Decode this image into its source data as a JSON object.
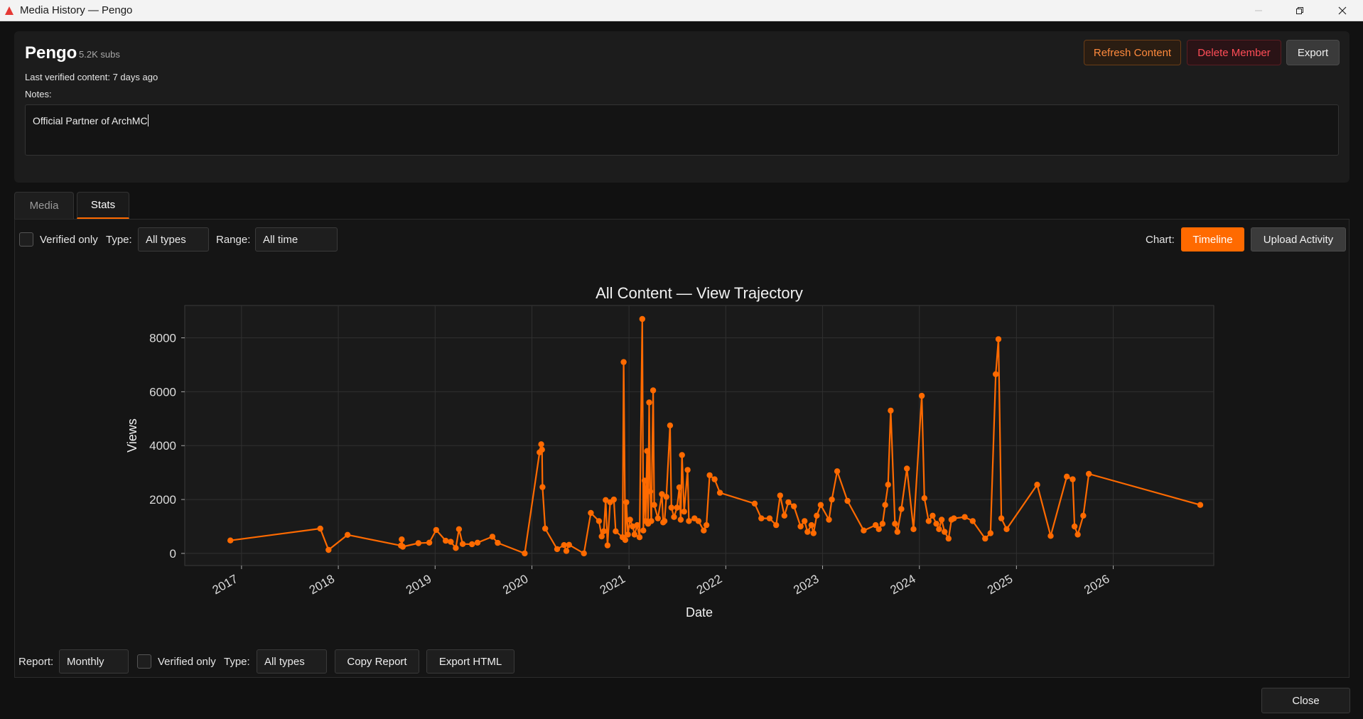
{
  "window": {
    "title": "Media History — Pengo"
  },
  "member": {
    "name": "Pengo",
    "subs": "5.2K subs",
    "last_verified": "Last verified content: 7 days ago",
    "notes_label": "Notes:",
    "notes_value": "Official Partner of ArchMC"
  },
  "header_buttons": {
    "refresh": "Refresh Content",
    "delete": "Delete Member",
    "export": "Export"
  },
  "tabs": [
    {
      "label": "Media",
      "active": false
    },
    {
      "label": "Stats",
      "active": true
    }
  ],
  "filters": {
    "verified_only": "Verified only",
    "type_label": "Type:",
    "type_value": "All types",
    "range_label": "Range:",
    "range_value": "All time",
    "chart_label": "Chart:",
    "chart_timeline": "Timeline",
    "chart_upload": "Upload Activity"
  },
  "report": {
    "report_label": "Report:",
    "report_value": "Monthly",
    "verified_only": "Verified only",
    "type_label": "Type:",
    "type_value": "All types",
    "copy": "Copy Report",
    "export_html": "Export HTML"
  },
  "close_label": "Close",
  "colors": {
    "accent": "#ff6a00",
    "background": "#111111",
    "panel": "#1c1c1c"
  },
  "chart_data": {
    "type": "line",
    "title": "All Content — View Trajectory",
    "xlabel": "Date",
    "ylabel": "Views",
    "xlim": [
      "2016-06-01",
      "2027-01-15"
    ],
    "ylim": [
      -450,
      9200
    ],
    "x_ticks": [
      "2017",
      "2018",
      "2019",
      "2020",
      "2021",
      "2022",
      "2023",
      "2024",
      "2025",
      "2026"
    ],
    "y_ticks": [
      0,
      2000,
      4000,
      6000,
      8000
    ],
    "grid": true,
    "series": [
      {
        "color": "#ff6a00",
        "points": [
          [
            "2016-11-20",
            480
          ],
          [
            "2017-10-25",
            920
          ],
          [
            "2017-11-25",
            130
          ],
          [
            "2018-02-05",
            690
          ],
          [
            "2018-08-25",
            290
          ],
          [
            "2018-08-28",
            520
          ],
          [
            "2018-09-01",
            250
          ],
          [
            "2018-10-30",
            380
          ],
          [
            "2018-12-10",
            400
          ],
          [
            "2019-01-05",
            870
          ],
          [
            "2019-02-10",
            470
          ],
          [
            "2019-03-01",
            430
          ],
          [
            "2019-03-20",
            200
          ],
          [
            "2019-04-01",
            900
          ],
          [
            "2019-04-15",
            350
          ],
          [
            "2019-05-20",
            340
          ],
          [
            "2019-06-10",
            400
          ],
          [
            "2019-08-05",
            620
          ],
          [
            "2019-08-25",
            390
          ],
          [
            "2019-12-05",
            0
          ],
          [
            "2020-01-30",
            3750
          ],
          [
            "2020-02-05",
            4050
          ],
          [
            "2020-02-08",
            3850
          ],
          [
            "2020-02-10",
            2460
          ],
          [
            "2020-02-20",
            920
          ],
          [
            "2020-04-05",
            160
          ],
          [
            "2020-05-01",
            310
          ],
          [
            "2020-05-10",
            90
          ],
          [
            "2020-05-20",
            320
          ],
          [
            "2020-07-15",
            0
          ],
          [
            "2020-08-10",
            1500
          ],
          [
            "2020-09-10",
            1200
          ],
          [
            "2020-09-20",
            630
          ],
          [
            "2020-09-28",
            820
          ],
          [
            "2020-10-05",
            1980
          ],
          [
            "2020-10-12",
            300
          ],
          [
            "2020-10-22",
            1900
          ],
          [
            "2020-11-05",
            2000
          ],
          [
            "2020-11-12",
            820
          ],
          [
            "2020-12-08",
            600
          ],
          [
            "2020-12-12",
            7100
          ],
          [
            "2020-12-18",
            500
          ],
          [
            "2020-12-22",
            1900
          ],
          [
            "2020-12-28",
            700
          ],
          [
            "2021-01-05",
            1250
          ],
          [
            "2021-01-15",
            1000
          ],
          [
            "2021-01-22",
            700
          ],
          [
            "2021-02-01",
            1050
          ],
          [
            "2021-02-10",
            600
          ],
          [
            "2021-02-20",
            8700
          ],
          [
            "2021-02-24",
            850
          ],
          [
            "2021-03-01",
            2700
          ],
          [
            "2021-03-05",
            1200
          ],
          [
            "2021-03-10",
            3800
          ],
          [
            "2021-03-14",
            1100
          ],
          [
            "2021-03-18",
            5600
          ],
          [
            "2021-03-22",
            2300
          ],
          [
            "2021-03-26",
            1200
          ],
          [
            "2021-04-02",
            6050
          ],
          [
            "2021-04-06",
            1800
          ],
          [
            "2021-04-20",
            1300
          ],
          [
            "2021-05-05",
            2200
          ],
          [
            "2021-05-10",
            1150
          ],
          [
            "2021-05-15",
            1200
          ],
          [
            "2021-05-22",
            2100
          ],
          [
            "2021-06-05",
            4750
          ],
          [
            "2021-06-10",
            1700
          ],
          [
            "2021-06-20",
            1350
          ],
          [
            "2021-07-01",
            1700
          ],
          [
            "2021-07-10",
            2450
          ],
          [
            "2021-07-15",
            1250
          ],
          [
            "2021-07-20",
            3650
          ],
          [
            "2021-07-28",
            1550
          ],
          [
            "2021-08-10",
            3100
          ],
          [
            "2021-08-15",
            1200
          ],
          [
            "2021-09-05",
            1300
          ],
          [
            "2021-09-20",
            1200
          ],
          [
            "2021-10-10",
            850
          ],
          [
            "2021-10-20",
            1050
          ],
          [
            "2021-11-01",
            2900
          ],
          [
            "2021-11-20",
            2750
          ],
          [
            "2021-12-10",
            2250
          ],
          [
            "2022-04-20",
            1850
          ],
          [
            "2022-05-15",
            1300
          ],
          [
            "2022-06-15",
            1300
          ],
          [
            "2022-07-10",
            1050
          ],
          [
            "2022-07-25",
            2150
          ],
          [
            "2022-08-10",
            1400
          ],
          [
            "2022-08-25",
            1900
          ],
          [
            "2022-09-15",
            1750
          ],
          [
            "2022-10-10",
            1000
          ],
          [
            "2022-10-25",
            1200
          ],
          [
            "2022-11-05",
            800
          ],
          [
            "2022-11-20",
            1050
          ],
          [
            "2022-11-28",
            750
          ],
          [
            "2022-12-10",
            1400
          ],
          [
            "2022-12-25",
            1800
          ],
          [
            "2023-01-25",
            1250
          ],
          [
            "2023-02-05",
            2000
          ],
          [
            "2023-02-25",
            3050
          ],
          [
            "2023-04-05",
            1950
          ],
          [
            "2023-06-05",
            850
          ],
          [
            "2023-07-20",
            1050
          ],
          [
            "2023-08-01",
            900
          ],
          [
            "2023-08-15",
            1100
          ],
          [
            "2023-08-25",
            1800
          ],
          [
            "2023-09-05",
            2550
          ],
          [
            "2023-09-15",
            5300
          ],
          [
            "2023-10-01",
            1100
          ],
          [
            "2023-10-10",
            800
          ],
          [
            "2023-10-25",
            1650
          ],
          [
            "2023-11-15",
            3150
          ],
          [
            "2023-12-10",
            900
          ],
          [
            "2024-01-10",
            5850
          ],
          [
            "2024-01-20",
            2050
          ],
          [
            "2024-02-05",
            1200
          ],
          [
            "2024-02-20",
            1400
          ],
          [
            "2024-03-05",
            1100
          ],
          [
            "2024-03-15",
            900
          ],
          [
            "2024-03-25",
            1250
          ],
          [
            "2024-04-05",
            800
          ],
          [
            "2024-04-20",
            550
          ],
          [
            "2024-05-01",
            1250
          ],
          [
            "2024-05-10",
            1300
          ],
          [
            "2024-06-20",
            1350
          ],
          [
            "2024-07-20",
            1200
          ],
          [
            "2024-09-05",
            550
          ],
          [
            "2024-09-25",
            750
          ],
          [
            "2024-10-15",
            6650
          ],
          [
            "2024-10-25",
            7950
          ],
          [
            "2024-11-05",
            1300
          ],
          [
            "2024-11-25",
            900
          ],
          [
            "2025-03-20",
            2550
          ],
          [
            "2025-05-10",
            650
          ],
          [
            "2025-07-10",
            2850
          ],
          [
            "2025-08-01",
            2750
          ],
          [
            "2025-08-08",
            1000
          ],
          [
            "2025-08-20",
            700
          ],
          [
            "2025-09-10",
            1400
          ],
          [
            "2025-10-01",
            2950
          ],
          [
            "2026-11-25",
            1800
          ]
        ]
      }
    ]
  }
}
